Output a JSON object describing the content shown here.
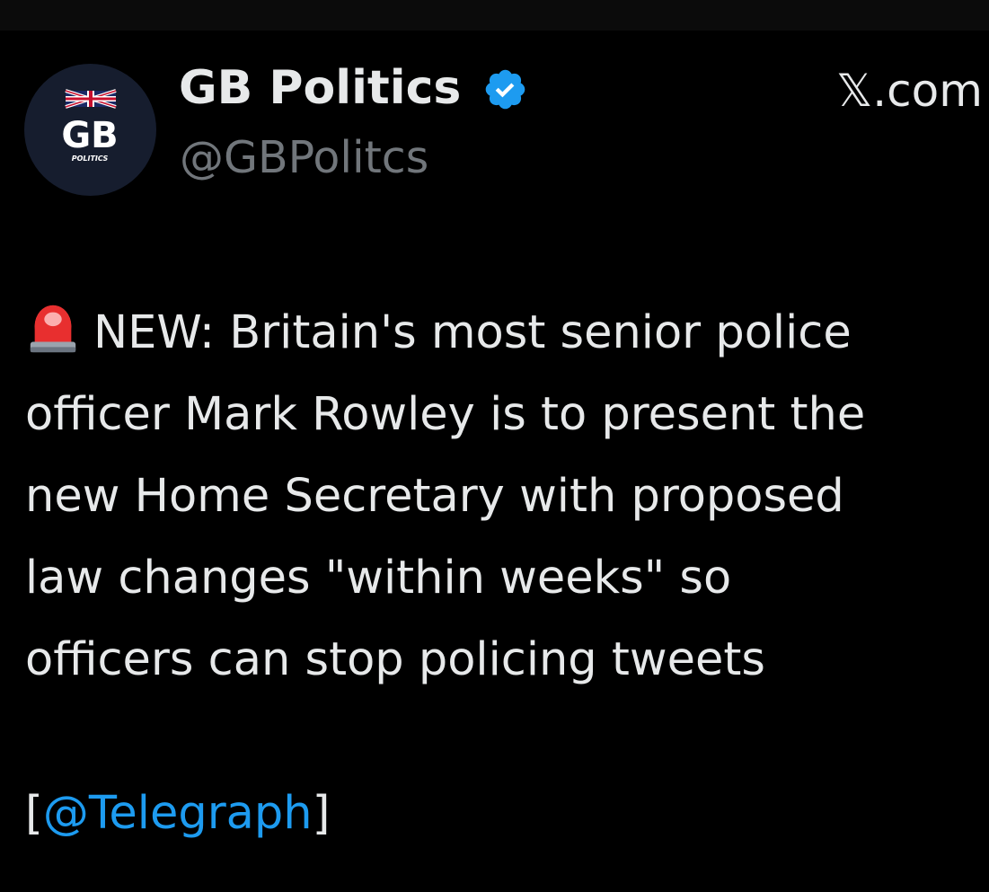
{
  "author": {
    "display_name": "GB Politics",
    "handle": "@GBPolitcs",
    "verified": true,
    "avatar": {
      "logo_text": "GB",
      "logo_subtext": "POLITICS"
    }
  },
  "source_site": "𝕏.com",
  "tweet": {
    "icon": "police-siren-icon",
    "lines": [
      "NEW: Britain's most senior police",
      "officer Mark Rowley is to present the",
      "new Home Secretary with proposed",
      "law changes \"within weeks\" so",
      "officers can stop policing tweets"
    ],
    "mention_open": "[",
    "mention": "@Telegraph",
    "mention_close": "]"
  },
  "colors": {
    "background": "#000000",
    "text": "#e7e9ea",
    "secondary": "#71767b",
    "link": "#1d9bf0",
    "verified_badge": "#1d9bf0"
  }
}
